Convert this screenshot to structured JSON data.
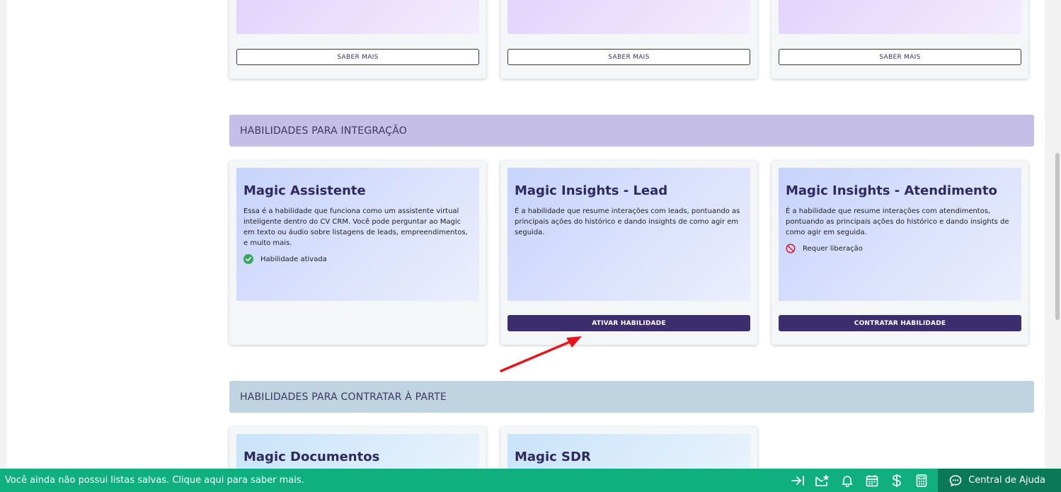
{
  "top_cards": [
    {
      "button": "SABER MAIS"
    },
    {
      "button": "SABER MAIS"
    },
    {
      "button": "SABER MAIS"
    }
  ],
  "sections": {
    "integration": "HABILIDADES PARA INTEGRAÇÃO",
    "separate": "HABILIDADES PARA CONTRATAR À PARTE"
  },
  "integration_cards": [
    {
      "title": "Magic Assistente",
      "description": "Essa é a habilidade que funciona como um assistente virtual inteligente dentro do CV CRM. Você pode perguntar ao Magic em texto ou áudio sobre listagens de leads, empreendimentos, e muito mais.",
      "status": "Habilidade ativada",
      "status_icon": "check-circle-icon"
    },
    {
      "title": "Magic Insights - Lead",
      "description": "É a habilidade que resume interações com leads, pontuando as principais ações do histórico e dando insights de como agir em seguida.",
      "button": "ATIVAR HABILIDADE"
    },
    {
      "title": "Magic Insights - Atendimento",
      "description": "É a habilidade que resume interações com atendimentos, pontuando as principais ações do histórico e dando insights de como agir em seguida.",
      "status": "Requer liberação",
      "status_icon": "prohibited-icon",
      "button": "CONTRATAR HABILIDADE"
    }
  ],
  "separate_cards": [
    {
      "title": "Magic Documentos"
    },
    {
      "title": "Magic SDR"
    }
  ],
  "bottom_bar": {
    "message": "Você ainda não possui listas salvas. Clique aqui para saber mais.",
    "icons": [
      "arrow-to-right-icon",
      "mail-star-icon",
      "bell-icon",
      "calendar-icon",
      "dollar-icon",
      "calculator-icon"
    ],
    "help_label": "Central de Ajuda"
  },
  "colors": {
    "accent": "#3b2d6e",
    "integration_header": "#c5bfe8",
    "separate_header": "#bfd4e0",
    "bottom_bar": "#0fb07e",
    "success": "#3aa55d",
    "danger": "#d9233c",
    "arrow": "#e8141b"
  }
}
